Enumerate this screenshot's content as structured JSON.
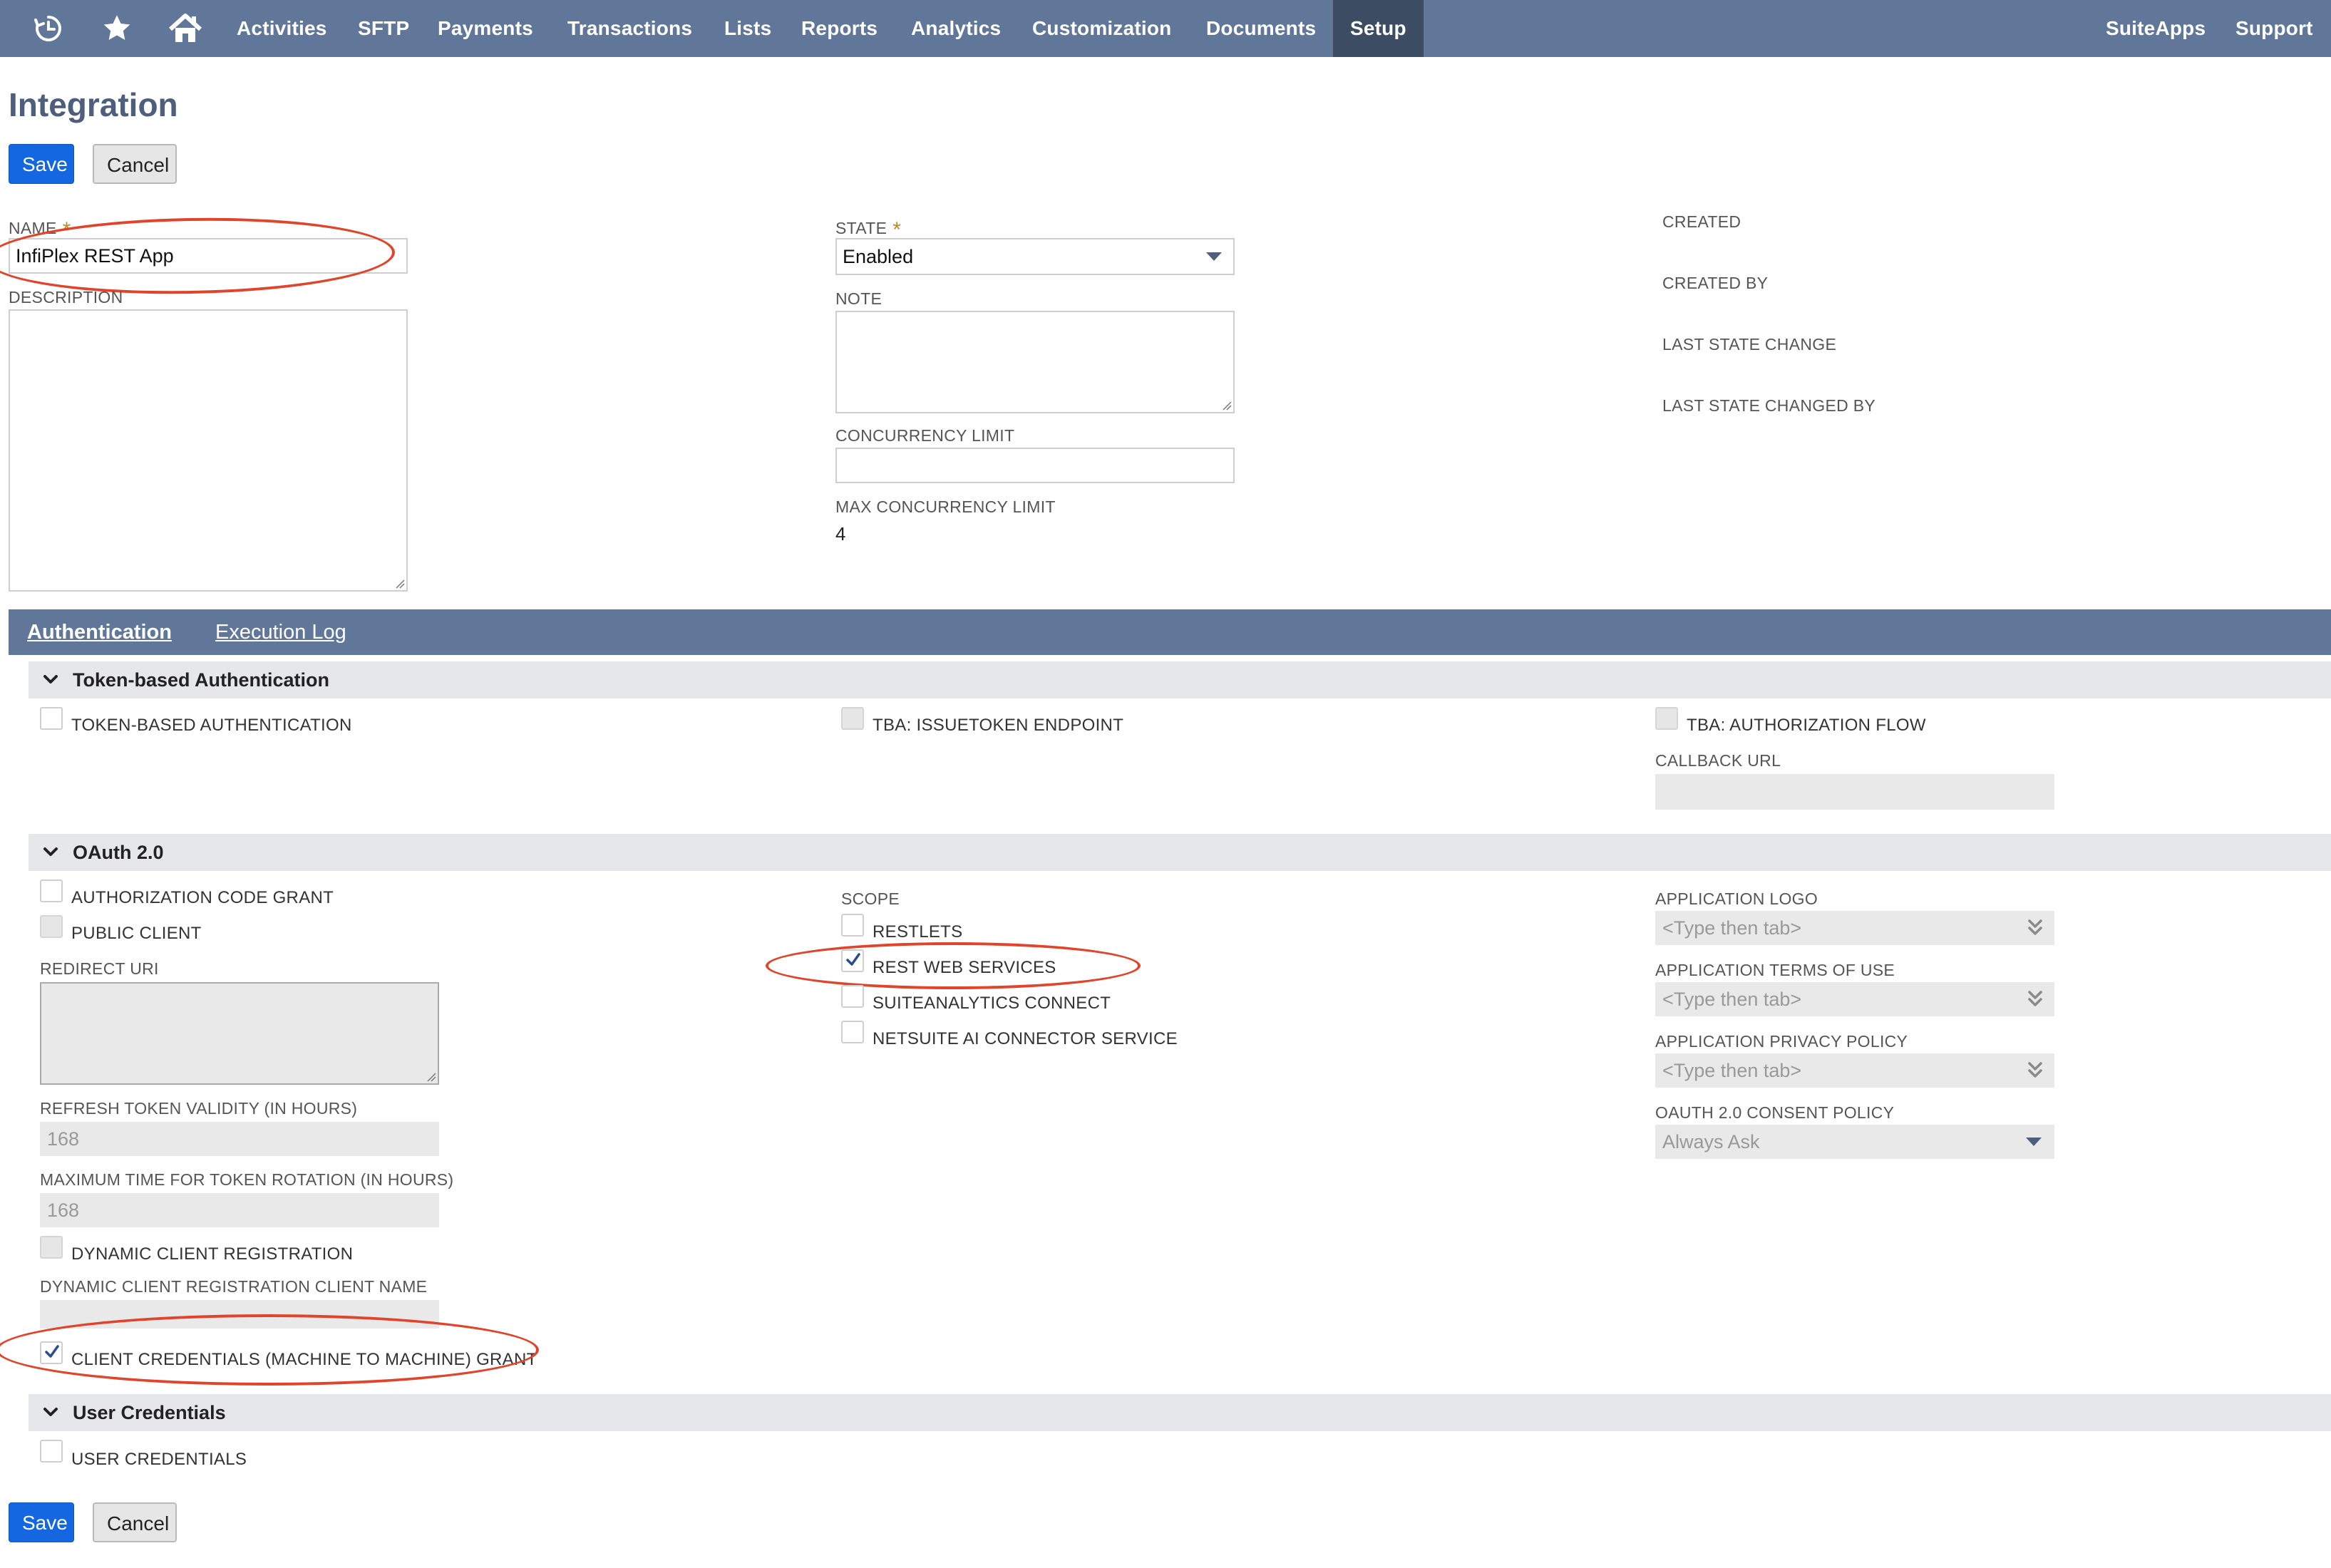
{
  "nav": {
    "icons": [
      "recent-records-icon",
      "favorites-star-icon",
      "home-icon"
    ],
    "items": [
      {
        "label": "Activities"
      },
      {
        "label": "SFTP"
      },
      {
        "label": "Payments"
      },
      {
        "label": "Transactions"
      },
      {
        "label": "Lists"
      },
      {
        "label": "Reports"
      },
      {
        "label": "Analytics"
      },
      {
        "label": "Customization"
      },
      {
        "label": "Documents"
      },
      {
        "label": "Setup",
        "active": true
      }
    ],
    "right_items": [
      {
        "label": "SuiteApps"
      },
      {
        "label": "Support"
      }
    ],
    "background_color": "#607799",
    "active_color": "#3b4c63"
  },
  "page": {
    "title": "Integration",
    "save_label": "Save",
    "cancel_label": "Cancel"
  },
  "primary_fields": {
    "name_label": "NAME",
    "name_value": "InfiPlex REST App",
    "description_label": "DESCRIPTION",
    "description_value": "",
    "state_label": "STATE",
    "state_value": "Enabled",
    "note_label": "NOTE",
    "note_value": "",
    "concurrency_limit_label": "CONCURRENCY LIMIT",
    "concurrency_limit_value": "",
    "max_concurrency_limit_label": "MAX CONCURRENCY LIMIT",
    "max_concurrency_limit_value": "4",
    "required_marker": "*"
  },
  "meta_fields": {
    "created_label": "CREATED",
    "created_by_label": "CREATED BY",
    "last_state_change_label": "LAST STATE CHANGE",
    "last_state_changed_by_label": "LAST STATE CHANGED BY"
  },
  "tabs": [
    {
      "label": "Authentication",
      "active": true
    },
    {
      "label": "Execution Log",
      "active": false
    }
  ],
  "tba_section": {
    "title": "Token-based Authentication",
    "token_based_auth_label": "TOKEN-BASED AUTHENTICATION",
    "token_based_auth_checked": false,
    "issuetoken_endpoint_label": "TBA: ISSUETOKEN ENDPOINT",
    "issuetoken_endpoint_checked": false,
    "authorization_flow_label": "TBA: AUTHORIZATION FLOW",
    "authorization_flow_checked": false,
    "callback_url_label": "CALLBACK URL",
    "callback_url_value": ""
  },
  "oauth_section": {
    "title": "OAuth 2.0",
    "authorization_code_grant_label": "AUTHORIZATION CODE GRANT",
    "authorization_code_grant_checked": false,
    "public_client_label": "PUBLIC CLIENT",
    "public_client_checked": false,
    "redirect_uri_label": "REDIRECT URI",
    "redirect_uri_value": "",
    "refresh_token_validity_label": "REFRESH TOKEN VALIDITY (IN HOURS)",
    "refresh_token_validity_value": "168",
    "max_token_rotation_label": "MAXIMUM TIME FOR TOKEN ROTATION (IN HOURS)",
    "max_token_rotation_value": "168",
    "dynamic_client_registration_label": "DYNAMIC CLIENT REGISTRATION",
    "dynamic_client_registration_checked": false,
    "dynamic_client_name_label": "DYNAMIC CLIENT REGISTRATION CLIENT NAME",
    "dynamic_client_name_value": "",
    "client_credentials_label": "CLIENT CREDENTIALS (MACHINE TO MACHINE) GRANT",
    "client_credentials_checked": true,
    "scope_label": "SCOPE",
    "scope_options": [
      {
        "label": "RESTLETS",
        "checked": false
      },
      {
        "label": "REST WEB SERVICES",
        "checked": true
      },
      {
        "label": "SUITEANALYTICS CONNECT",
        "checked": false
      },
      {
        "label": "NETSUITE AI CONNECTOR SERVICE",
        "checked": false
      }
    ],
    "application_logo_label": "APPLICATION LOGO",
    "application_logo_placeholder": "<Type then tab>",
    "application_terms_label": "APPLICATION TERMS OF USE",
    "application_terms_placeholder": "<Type then tab>",
    "application_privacy_label": "APPLICATION PRIVACY POLICY",
    "application_privacy_placeholder": "<Type then tab>",
    "consent_policy_label": "OAUTH 2.0 CONSENT POLICY",
    "consent_policy_value": "Always Ask"
  },
  "user_credentials_section": {
    "title": "User Credentials",
    "user_credentials_label": "USER CREDENTIALS",
    "user_credentials_checked": false
  },
  "annotation_color": "#e0452c",
  "primary_button_color": "#1467e0"
}
